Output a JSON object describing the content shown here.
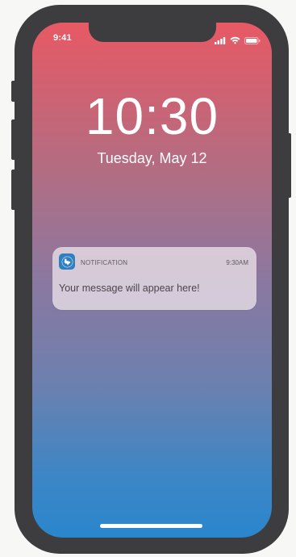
{
  "status_bar": {
    "time": "9:41",
    "icons": [
      "signal-icon",
      "wifi-icon",
      "battery-icon"
    ]
  },
  "lock_screen": {
    "clock": "10:30",
    "date": "Tuesday, May 12"
  },
  "notification": {
    "app_icon": "texas-state-icon",
    "app_name": "NOTIFICATION",
    "time": "9:30AM",
    "message": "Your message will appear here!"
  },
  "colors": {
    "gradient_top": "#e75964",
    "gradient_bottom": "#2a86cc",
    "phone_frame": "#3d3d3f",
    "app_icon_bg": "#2f7fc1"
  }
}
